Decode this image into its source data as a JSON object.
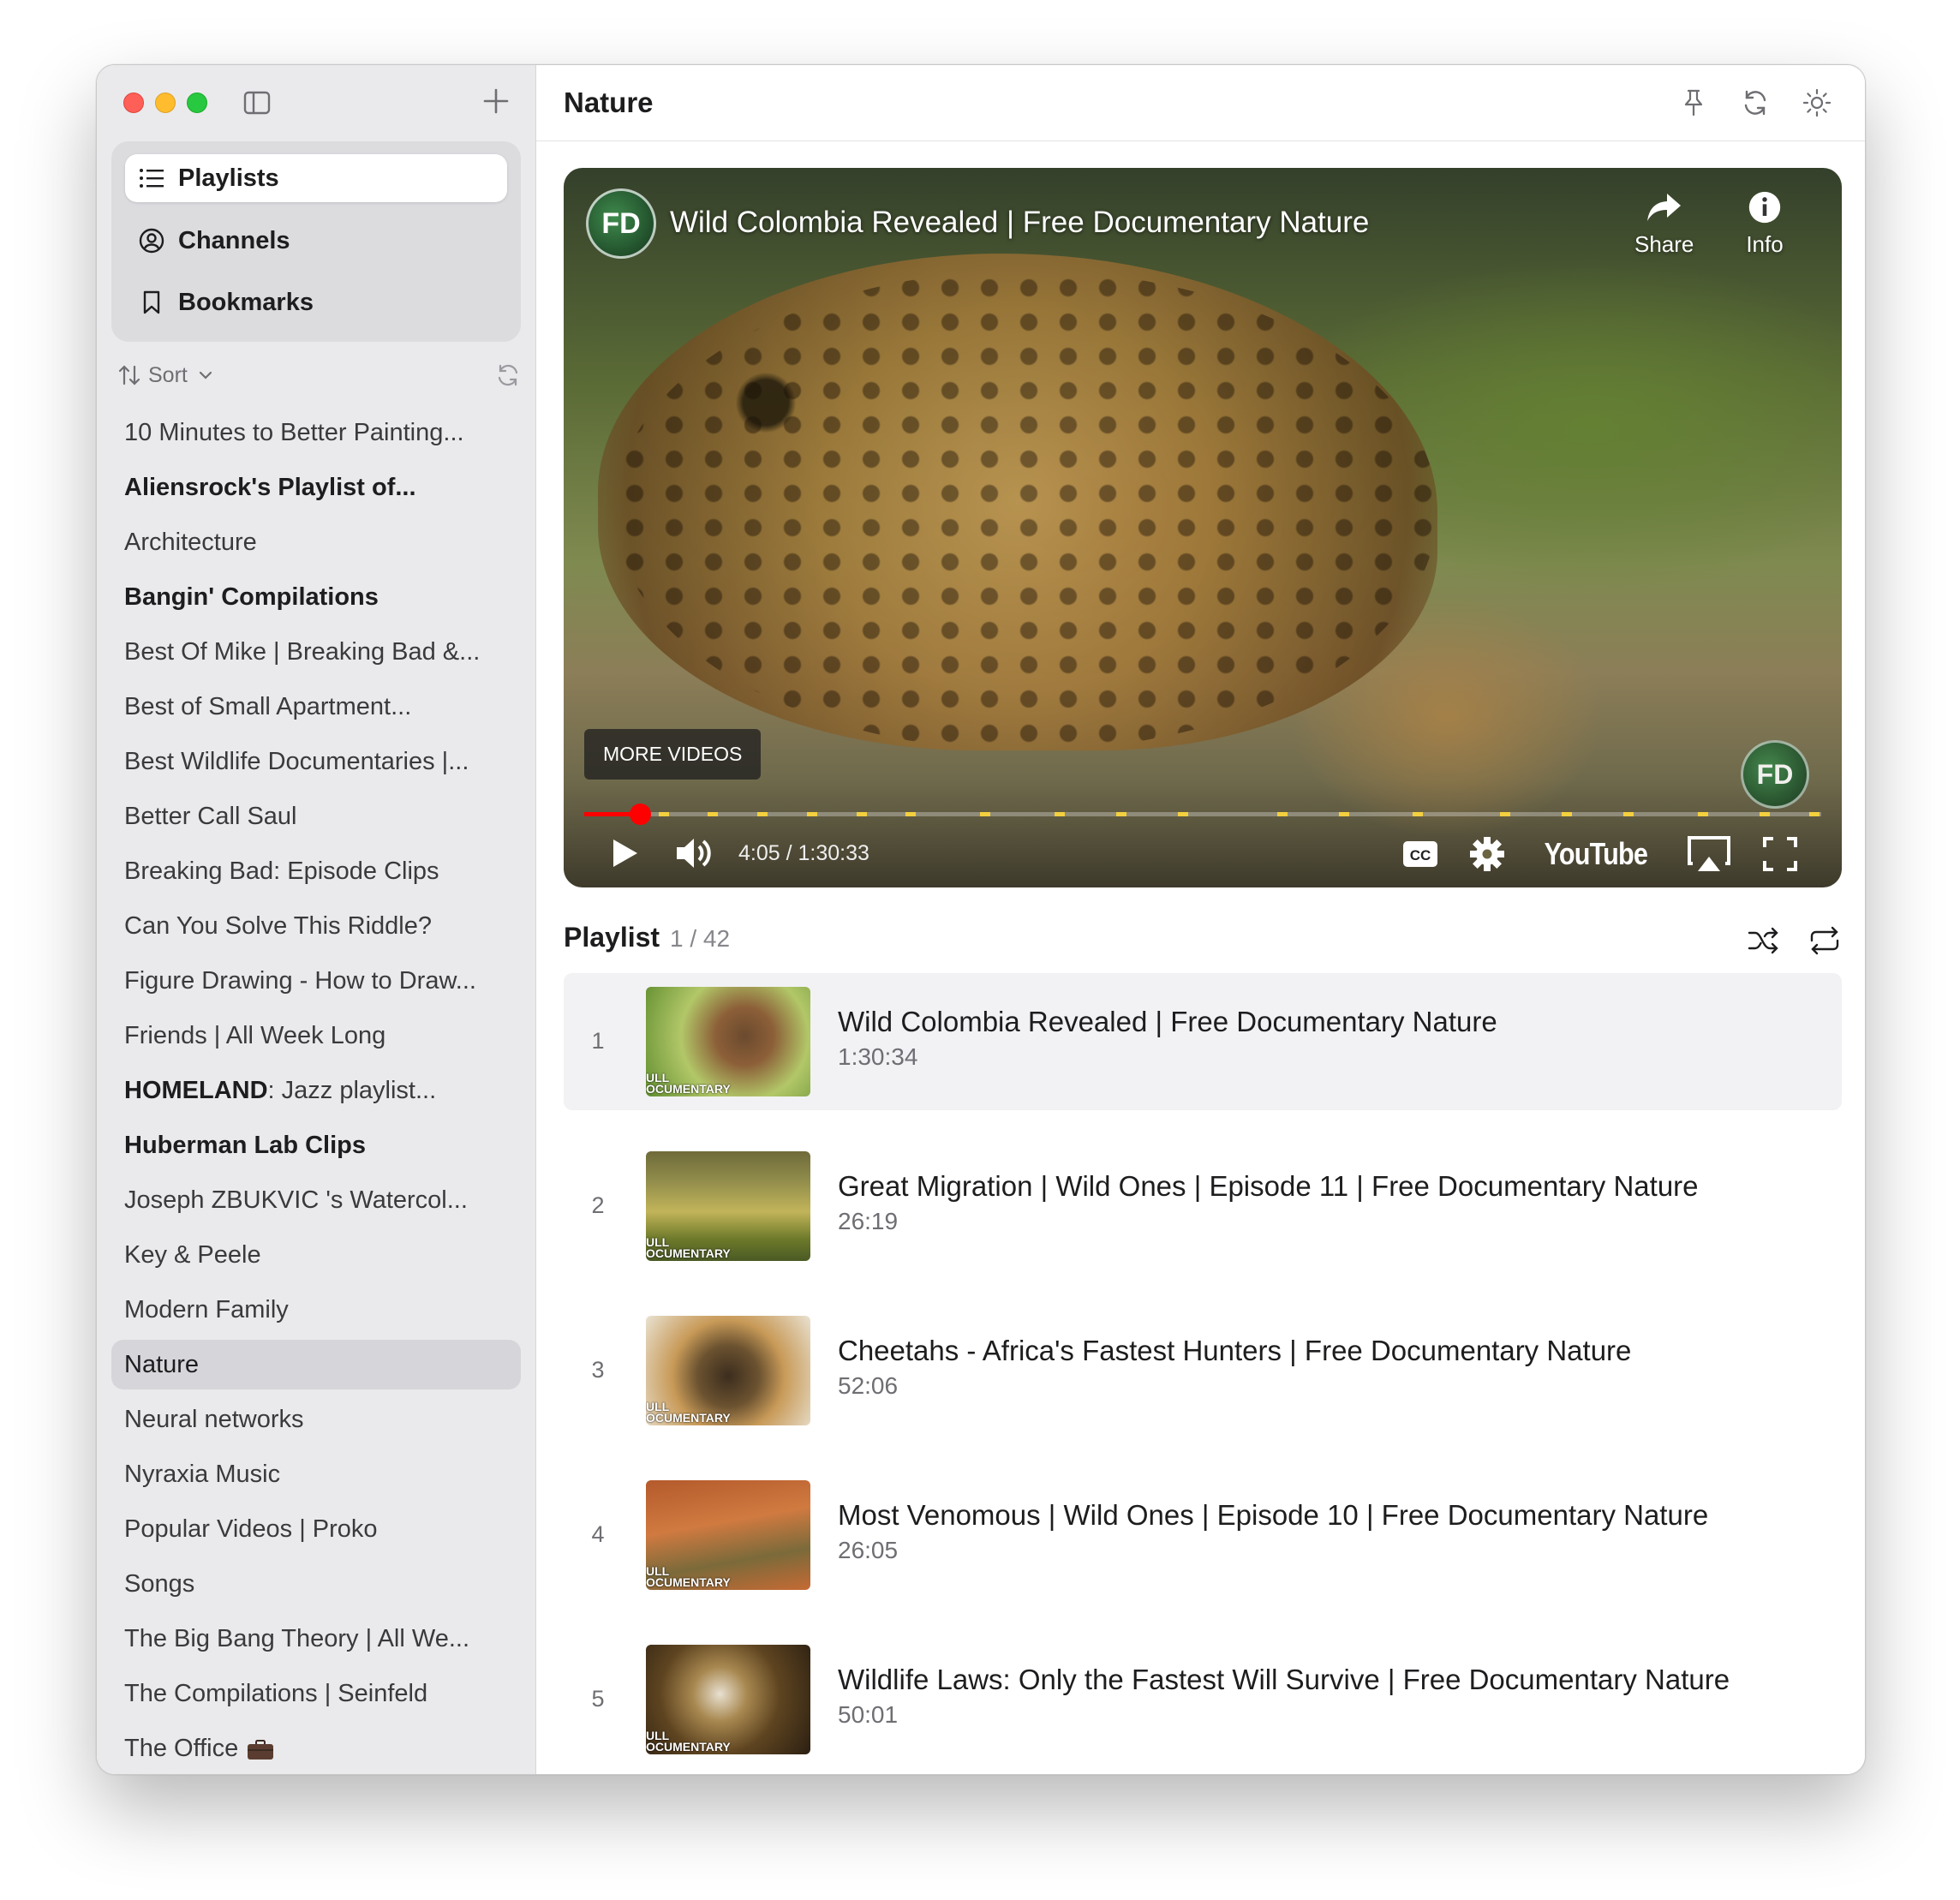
{
  "window": {
    "colors": {
      "sidebar_bg": "#eaeaec",
      "selected": "#d6d6da",
      "accent_red": "#ff0000"
    }
  },
  "sidebar": {
    "nav": [
      {
        "label": "Playlists",
        "icon": "list-icon",
        "active": true
      },
      {
        "label": "Channels",
        "icon": "person-circle-icon",
        "active": false
      },
      {
        "label": "Bookmarks",
        "icon": "bookmark-icon",
        "active": false
      }
    ],
    "sort_label": "Sort",
    "playlists": [
      {
        "label": "10 Minutes to Better Painting...",
        "bold": false
      },
      {
        "label": "Aliensrock's Playlist of...",
        "bold": true
      },
      {
        "label": "Architecture",
        "bold": false
      },
      {
        "label": "Bangin' Compilations",
        "bold": true
      },
      {
        "label": "Best Of Mike | Breaking Bad &...",
        "bold": false
      },
      {
        "label": "Best of Small Apartment...",
        "bold": false
      },
      {
        "label": "Best Wildlife Documentaries |...",
        "bold": false
      },
      {
        "label": "Better Call Saul",
        "bold": false
      },
      {
        "label": "Breaking Bad: Episode Clips",
        "bold": false
      },
      {
        "label": "Can You Solve This Riddle?",
        "bold": false
      },
      {
        "label": "Figure Drawing - How to Draw...",
        "bold": false
      },
      {
        "label": "Friends | All Week Long",
        "bold": false
      },
      {
        "label": "HOMELAND: Jazz playlist...",
        "bold": false,
        "bold_prefix": "HOMELAND",
        "rest": ": Jazz playlist..."
      },
      {
        "label": "Huberman Lab Clips",
        "bold": true
      },
      {
        "label": "Joseph ZBUKVIC 's Watercol...",
        "bold": false
      },
      {
        "label": "Key & Peele",
        "bold": false
      },
      {
        "label": "Modern Family",
        "bold": false
      },
      {
        "label": "Nature",
        "bold": false,
        "selected": true
      },
      {
        "label": "Neural networks",
        "bold": false
      },
      {
        "label": "Nyraxia Music",
        "bold": false
      },
      {
        "label": "Popular Videos | Proko",
        "bold": false
      },
      {
        "label": "Songs",
        "bold": false
      },
      {
        "label": "The Big Bang Theory | All We...",
        "bold": false
      },
      {
        "label": "The Compilations | Seinfeld",
        "bold": false
      },
      {
        "label": "The Office",
        "bold": false,
        "emoji": "briefcase-icon"
      }
    ]
  },
  "header": {
    "title": "Nature",
    "icons": [
      "pin-icon",
      "refresh-icon",
      "sun-icon"
    ]
  },
  "player": {
    "channel_logo_text": "FD",
    "video_title": "Wild Colombia Revealed | Free Documentary Nature",
    "share_label": "Share",
    "info_label": "Info",
    "more_videos_label": "MORE VIDEOS",
    "time": "4:05 / 1:30:33",
    "progress_fraction": 0.045,
    "chapter_markers": [
      0.06,
      0.1,
      0.14,
      0.18,
      0.22,
      0.26,
      0.32,
      0.38,
      0.43,
      0.48,
      0.56,
      0.61,
      0.67,
      0.74,
      0.79,
      0.84,
      0.9,
      0.95,
      0.99
    ],
    "brand": "YouTube"
  },
  "playlist": {
    "title": "Playlist",
    "count": "1 / 42",
    "items": [
      {
        "index": "1",
        "title": "Wild Colombia Revealed | Free Documentary Nature",
        "duration": "1:30:34",
        "current": true,
        "thumb_tag": "ULL\nOCUMENTARY"
      },
      {
        "index": "2",
        "title": "Great Migration | Wild Ones | Episode 11 | Free Documentary Nature",
        "duration": "26:19",
        "current": false,
        "thumb_tag": "ULL\nOCUMENTARY"
      },
      {
        "index": "3",
        "title": "Cheetahs - Africa's Fastest Hunters | Free Documentary Nature",
        "duration": "52:06",
        "current": false,
        "thumb_tag": "ULL\nOCUMENTARY"
      },
      {
        "index": "4",
        "title": "Most Venomous | Wild Ones | Episode 10 | Free Documentary Nature",
        "duration": "26:05",
        "current": false,
        "thumb_tag": "ULL\nOCUMENTARY"
      },
      {
        "index": "5",
        "title": "Wildlife Laws: Only the Fastest Will Survive | Free Documentary Nature",
        "duration": "50:01",
        "current": false,
        "thumb_tag": "ULL\nOCUMENTARY"
      }
    ]
  }
}
